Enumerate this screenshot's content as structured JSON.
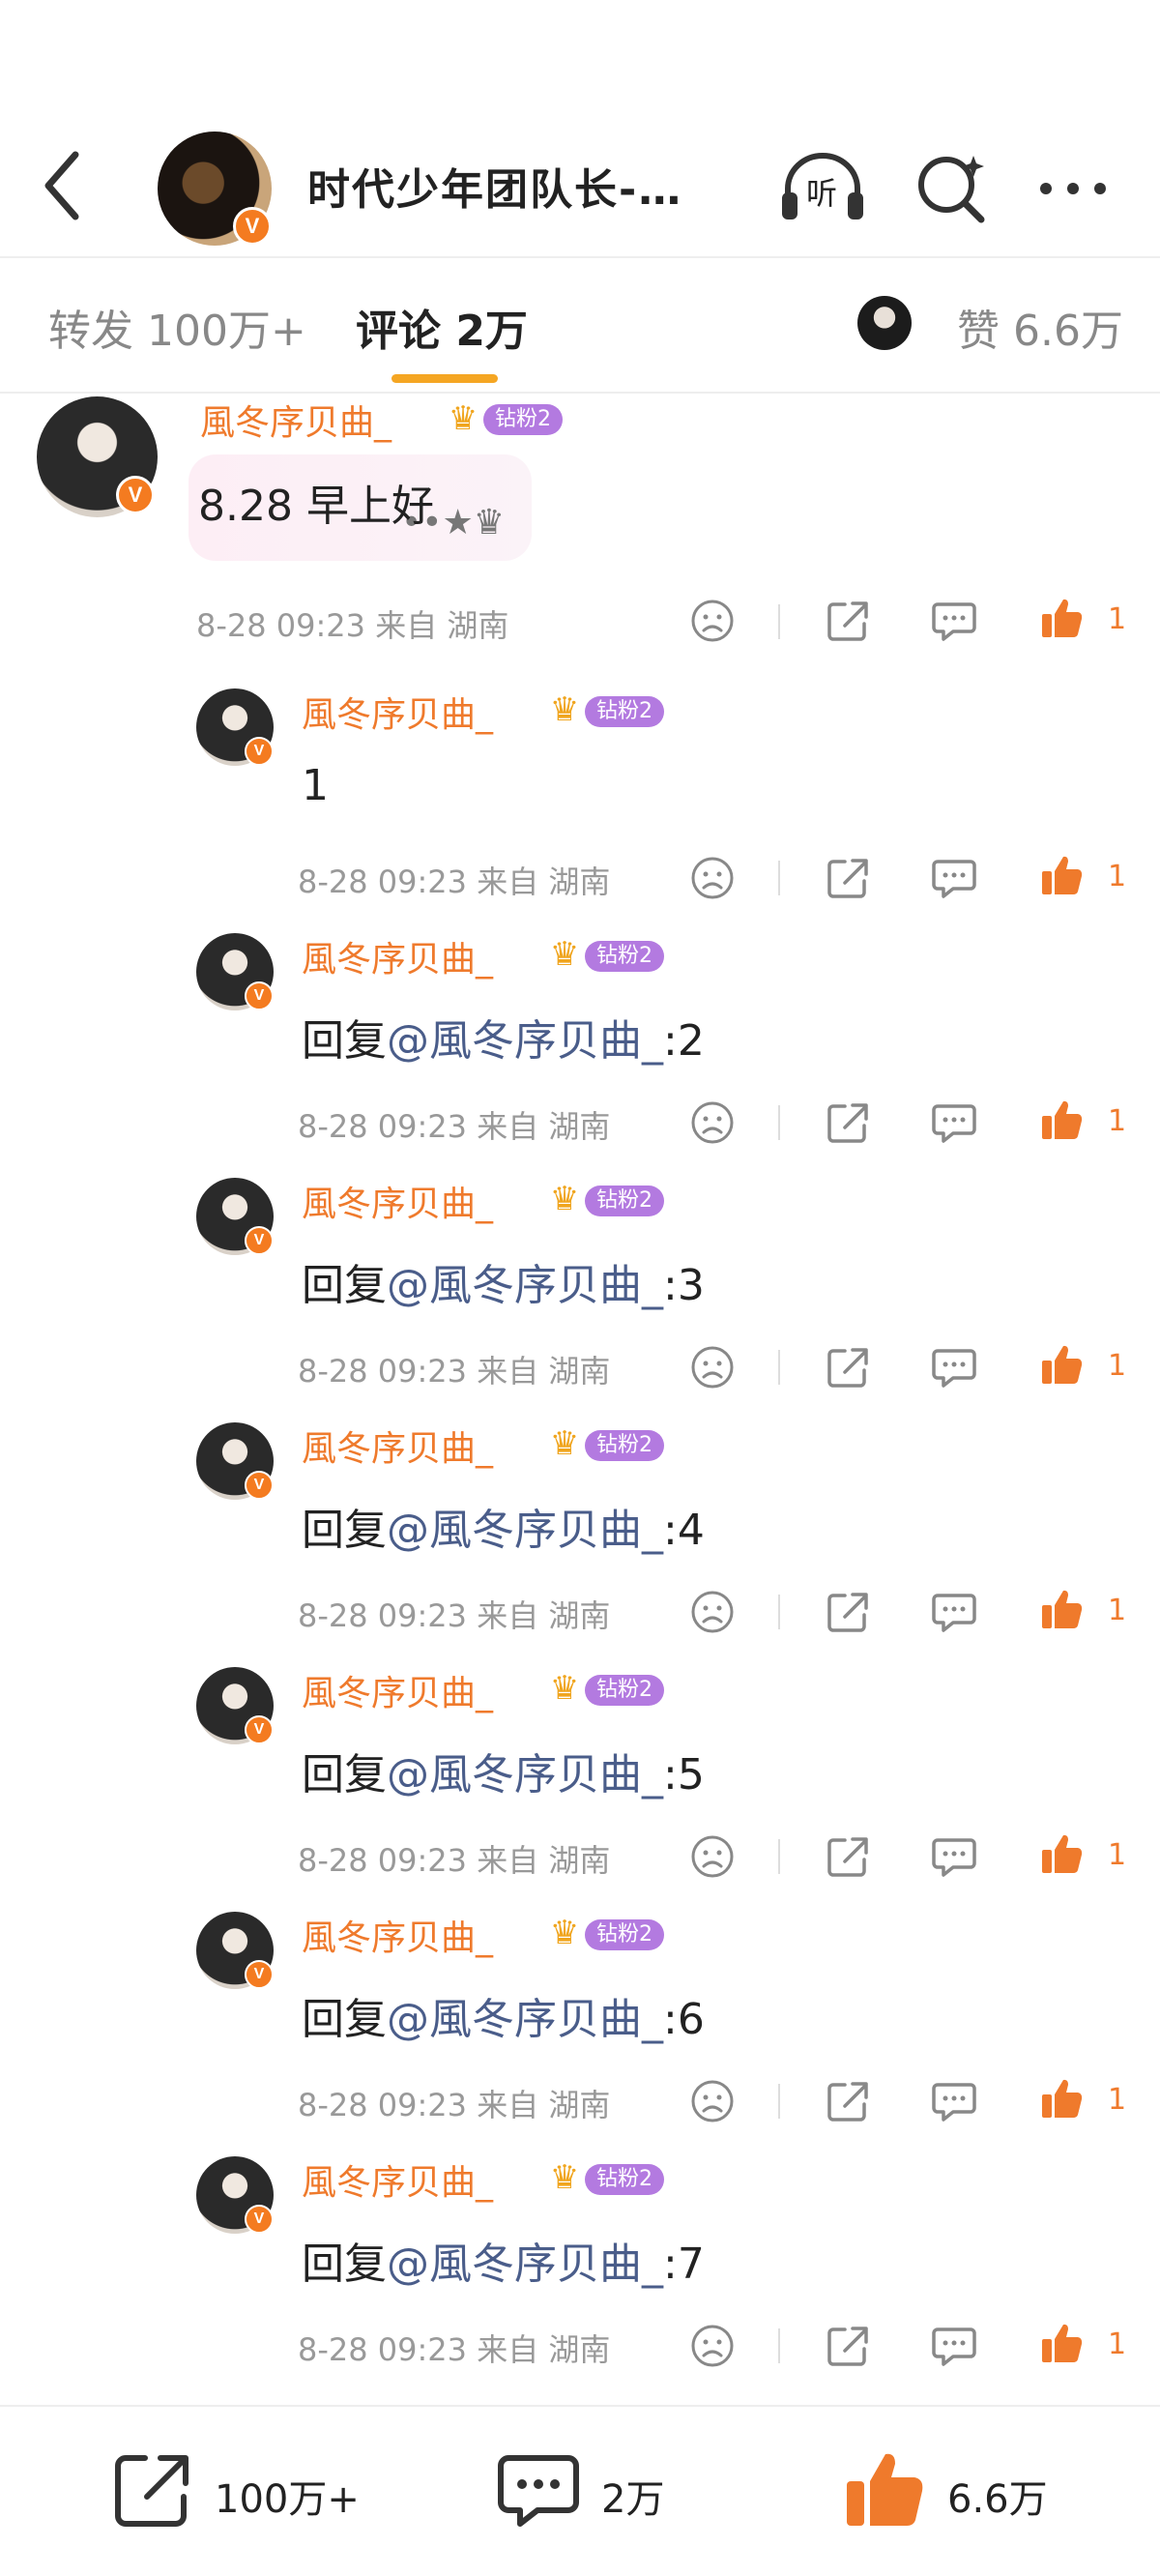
{
  "header": {
    "title": "时代少年团队长-…",
    "listen_label": "听",
    "verified_badge": "V"
  },
  "tabs": {
    "repost_label": "转发 100万+",
    "comments_label": "评论 2万",
    "likes_label": "赞 6.6万"
  },
  "main_comment": {
    "username": "風冬序贝曲_",
    "fan_badge": "钻粉2",
    "text": "8.28 早上好",
    "bubble_deco": "••★♛",
    "meta": "8-28 09:23 来自 湖南",
    "like_count": "1"
  },
  "replies": [
    {
      "username": "風冬序贝曲_",
      "fan_badge": "钻粉2",
      "prefix": "1",
      "mention": "",
      "suffix": "",
      "meta": "8-28 09:23 来自 湖南",
      "like_count": "1"
    },
    {
      "username": "風冬序贝曲_",
      "fan_badge": "钻粉2",
      "prefix": "回复",
      "mention": "@風冬序贝曲_",
      "suffix": ":2",
      "meta": "8-28 09:23 来自 湖南",
      "like_count": "1"
    },
    {
      "username": "風冬序贝曲_",
      "fan_badge": "钻粉2",
      "prefix": "回复",
      "mention": "@風冬序贝曲_",
      "suffix": ":3",
      "meta": "8-28 09:23 来自 湖南",
      "like_count": "1"
    },
    {
      "username": "風冬序贝曲_",
      "fan_badge": "钻粉2",
      "prefix": "回复",
      "mention": "@風冬序贝曲_",
      "suffix": ":4",
      "meta": "8-28 09:23 来自 湖南",
      "like_count": "1"
    },
    {
      "username": "風冬序贝曲_",
      "fan_badge": "钻粉2",
      "prefix": "回复",
      "mention": "@風冬序贝曲_",
      "suffix": ":5",
      "meta": "8-28 09:23 来自 湖南",
      "like_count": "1"
    },
    {
      "username": "風冬序贝曲_",
      "fan_badge": "钻粉2",
      "prefix": "回复",
      "mention": "@風冬序贝曲_",
      "suffix": ":6",
      "meta": "8-28 09:23 来自 湖南",
      "like_count": "1"
    },
    {
      "username": "風冬序贝曲_",
      "fan_badge": "钻粉2",
      "prefix": "回复",
      "mention": "@風冬序贝曲_",
      "suffix": ":7",
      "meta": "8-28 09:23 来自 湖南",
      "like_count": "1"
    }
  ],
  "bottom_bar": {
    "repost_count": "100万+",
    "comment_count": "2万",
    "like_count": "6.6万"
  },
  "icons": {
    "back": "back-arrow-icon",
    "listen": "headphones-icon",
    "search": "search-sparkle-icon",
    "more": "more-dots-icon",
    "dislike": "sad-face-icon",
    "share": "share-icon",
    "reply": "comment-bubble-icon",
    "like": "thumbs-up-icon",
    "crown": "crown-icon"
  },
  "colors": {
    "accent_orange": "#ef7a2c",
    "tab_underline": "#f5a623",
    "fan_badge_purple": "#b37ae0",
    "mention_blue": "#4a5d8a",
    "meta_gray": "#999999"
  }
}
